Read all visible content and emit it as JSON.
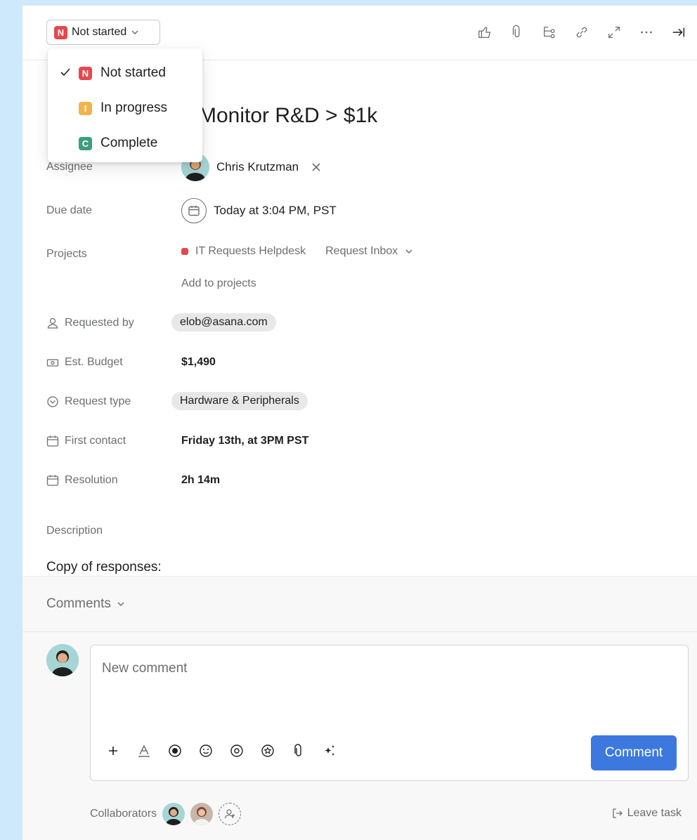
{
  "colors": {
    "not_started": "#e5484d",
    "in_progress": "#f1b44c",
    "complete": "#3a9e7a",
    "accent": "#3d78df",
    "project": "#e5484d",
    "backdrop": "#cde9fb"
  },
  "status": {
    "current_badge": "N",
    "current_label": "Not started",
    "options": [
      {
        "badge": "N",
        "label": "Not started",
        "selected": true
      },
      {
        "badge": "I",
        "label": "In progress",
        "selected": false
      },
      {
        "badge": "C",
        "label": "Complete",
        "selected": false
      }
    ]
  },
  "toolbar": {
    "icons": [
      "like-icon",
      "attachment-icon",
      "subtask-icon",
      "link-icon",
      "expand-icon",
      "more-icon",
      "close-panel-icon"
    ]
  },
  "task": {
    "title": "t: Monitor R&D > $1k"
  },
  "fields": {
    "assignee": {
      "label": "Assignee",
      "value": "Chris Krutzman"
    },
    "due_date": {
      "label": "Due date",
      "value": "Today at 3:04 PM, PST"
    },
    "projects": {
      "label": "Projects",
      "project": "IT Requests Helpdesk",
      "section": "Request Inbox",
      "add": "Add to projects"
    },
    "requested_by": {
      "label": "Requested by",
      "value": "elob@asana.com"
    },
    "est_budget": {
      "label": "Est. Budget",
      "value": "$1,490"
    },
    "request_type": {
      "label": "Request type",
      "value": "Hardware & Peripherals"
    },
    "first_contact": {
      "label": "First contact",
      "value": "Friday 13th, at 3PM PST"
    },
    "resolution": {
      "label": "Resolution",
      "value": "2h 14m"
    }
  },
  "description": {
    "label": "Description",
    "text": "Copy of responses:"
  },
  "comments": {
    "header": "Comments",
    "placeholder": "New comment",
    "button": "Comment",
    "collaborators_label": "Collaborators",
    "leave": "Leave task"
  }
}
